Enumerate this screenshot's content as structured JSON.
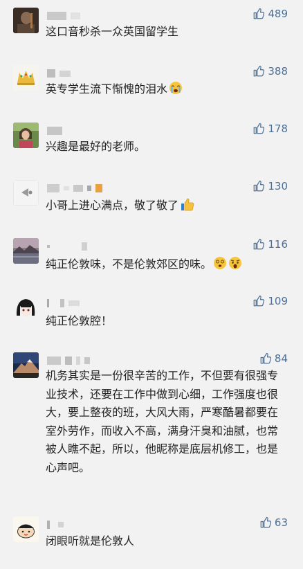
{
  "colors": {
    "background": "#f2f2f2",
    "like": "#4d6f94",
    "text": "#222222"
  },
  "comments": [
    {
      "likes": "489",
      "text": "这口音秒杀一众英国留学生",
      "avatar": "man-portrait",
      "icon": "thumbs-up-icon"
    },
    {
      "likes": "388",
      "text": "英专学生流下惭愧的泪水",
      "avatar": "crown-emoji",
      "trail_emoji": "crying-emoji"
    },
    {
      "likes": "178",
      "text": "兴趣是最好的老师。",
      "avatar": "woman-portrait"
    },
    {
      "likes": "130",
      "text": "小哥上进心满点，敬了敬了",
      "avatar": "fish-logo",
      "trail_emoji": "thumbs-up-emoji"
    },
    {
      "likes": "116",
      "text": "纯正伦敦味，不是伦敦郊区的味。",
      "avatar": "lake-landscape",
      "trail_emoji": "dizzy-face-emoji"
    },
    {
      "likes": "109",
      "text": "纯正伦敦腔！",
      "avatar": "anime-girl"
    },
    {
      "likes": "84",
      "text": "机务其实是一份很辛苦的工作，不但要有很强专业技术，还要在工作中做到心细，工作强度也很大，要上整夜的班，大风大雨，严寒酷暑都要在室外劳作，而收入不高，满身汗臭和油腻，也常被人瞧不起，所以，他昵称是底层机修工，也是心声吧。",
      "avatar": "mountain-night"
    },
    {
      "likes": "63",
      "text": "闭眼听就是伦敦人",
      "avatar": "cartoon-kid"
    }
  ]
}
